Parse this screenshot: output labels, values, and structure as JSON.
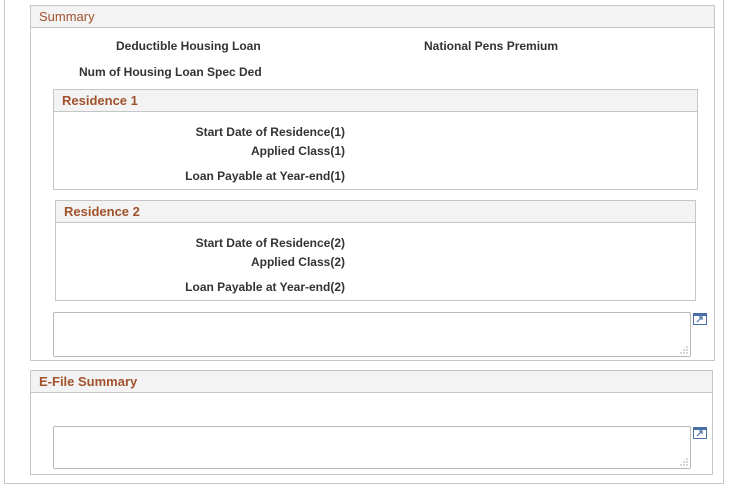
{
  "summary": {
    "title": "Summary",
    "deductible_housing_loan_label": "Deductible Housing Loan",
    "national_pens_premium_label": "National Pens Premium",
    "num_housing_loan_spec_ded_label": "Num of Housing Loan Spec Ded",
    "residence1": {
      "title": "Residence 1",
      "start_date_label": "Start Date of Residence(1)",
      "applied_class_label": "Applied Class(1)",
      "loan_payable_label": "Loan Payable at Year-end(1)"
    },
    "residence2": {
      "title": "Residence 2",
      "start_date_label": "Start Date of Residence(2)",
      "applied_class_label": "Applied Class(2)",
      "loan_payable_label": "Loan Payable at Year-end(2)"
    },
    "notes_value": ""
  },
  "efile_summary": {
    "title": "E-File Summary",
    "notes_value": ""
  },
  "icons": {
    "expand": "expand-textarea-icon",
    "resize": "resize-grip-icon"
  },
  "colors": {
    "header_text": "#a0522d",
    "header_bg": "#f3f3f3",
    "border": "#c6c6c6"
  }
}
